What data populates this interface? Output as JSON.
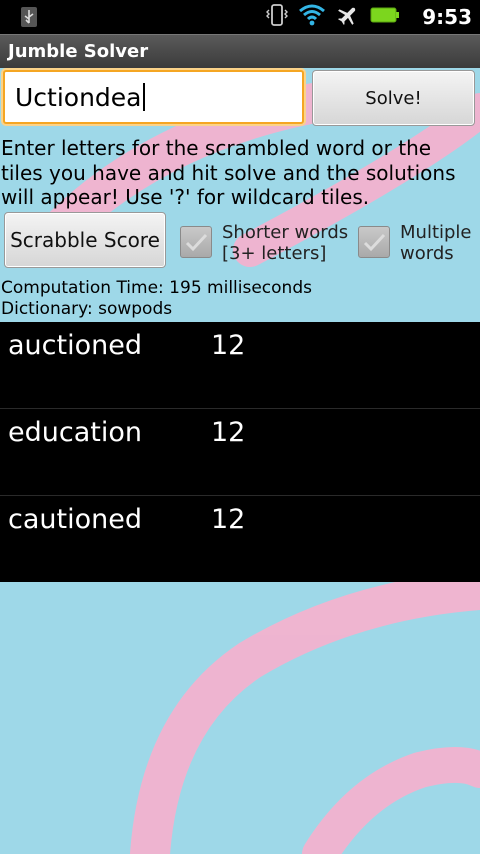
{
  "status_bar": {
    "time": "9:53",
    "icons": [
      "usb-icon",
      "vibrate-icon",
      "wifi-icon",
      "airplane-icon",
      "battery-icon"
    ]
  },
  "app": {
    "title": "Jumble Solver"
  },
  "input": {
    "value": "Uctiondea"
  },
  "solve_button": {
    "label": "Solve!"
  },
  "instructions": "Enter letters for the scrambled word or the tiles you have and hit solve and the solutions will appear! Use '?' for wildcard tiles.",
  "scrabble_button": {
    "label": "Scrabble Score"
  },
  "options": {
    "shorter": {
      "line1": "Shorter words",
      "line2": "[3+ letters]",
      "checked": true
    },
    "multiple": {
      "line1": "Multiple",
      "line2": "words",
      "checked": true
    }
  },
  "info": {
    "computation": "Computation Time: 195 milliseconds",
    "dictionary": "Dictionary: sowpods"
  },
  "results": [
    {
      "word": "auctioned",
      "score": "12"
    },
    {
      "word": "education",
      "score": "12"
    },
    {
      "word": "cautioned",
      "score": "12"
    }
  ],
  "colors": {
    "background": "#9ed8e8",
    "decor_stroke": "#f3b3cf",
    "focus_border": "#f5a623",
    "battery": "#7cd61e"
  }
}
